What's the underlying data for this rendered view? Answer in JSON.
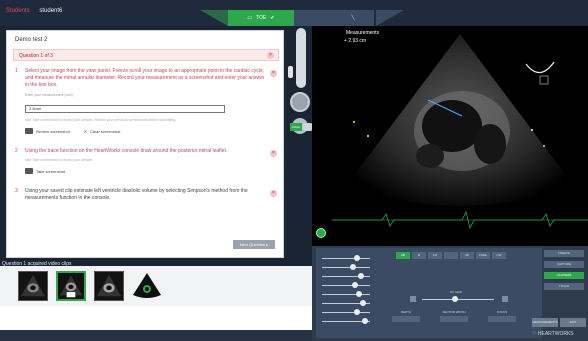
{
  "breadcrumbs": [
    "Students",
    "student6"
  ],
  "mode_tabs": [
    {
      "label": "TOE",
      "active": true
    },
    {
      "label": "",
      "active": false
    },
    {
      "label": "",
      "active": false
    }
  ],
  "quiz": {
    "title": "Demo test 2",
    "question_header": "Question 1 of 3",
    "questions": [
      {
        "num": "1",
        "text": "Select your image from the view panel. Freeze scroll your image to an appropriate point in the cardiac cycle, and measure the mitral annular diameter. Record your measurement as a screenshot and enter your answer in the text box.",
        "field_label": "Enter your measurement (mm)",
        "field_value": "2.5mm",
        "hint": "Use Take screenshot to record your answer. Review your previous screenshots before submitting.",
        "buttons": [
          "Review screenshot",
          "Clear screenshot"
        ]
      },
      {
        "num": "2",
        "text": "Using the trace function on the HeartWorks console draw around the posterior mitral leaflet.",
        "hint": "Use Take screenshot to record your answer.",
        "buttons": [
          "Take screenshot"
        ]
      },
      {
        "num": "3",
        "text": "Using your saved clip estimate left ventricle diastolic volume by selecting Simpson's method from the measurements function in the console."
      }
    ],
    "next_label": "Next Question"
  },
  "clips_label": "Question 1 acquired video clips",
  "probe": {
    "toggle_left": "Active",
    "toggle_right": "Manual"
  },
  "ultrasound": {
    "title": "Measurements",
    "measurement": "+ 2.93 cm"
  },
  "console": {
    "presets": [
      "2D",
      "M",
      "CD",
      "",
      "3D",
      "FREE",
      "CW"
    ],
    "slider_label": "2D GAIN",
    "depth_groups": [
      "DEPTH",
      "SECTOR WIDTH",
      "FOCUS"
    ],
    "right_buttons": [
      "FREEZE",
      "CAPTURE",
      "CALIPERS",
      "TRACE"
    ],
    "bottom_buttons": [
      "MEASUREMENTS",
      "EXIT"
    ]
  },
  "brand": "HEARTWORKS",
  "colors": {
    "accent": "#2da84a",
    "alert": "#c9455a",
    "bar": "#1f2b3c"
  }
}
